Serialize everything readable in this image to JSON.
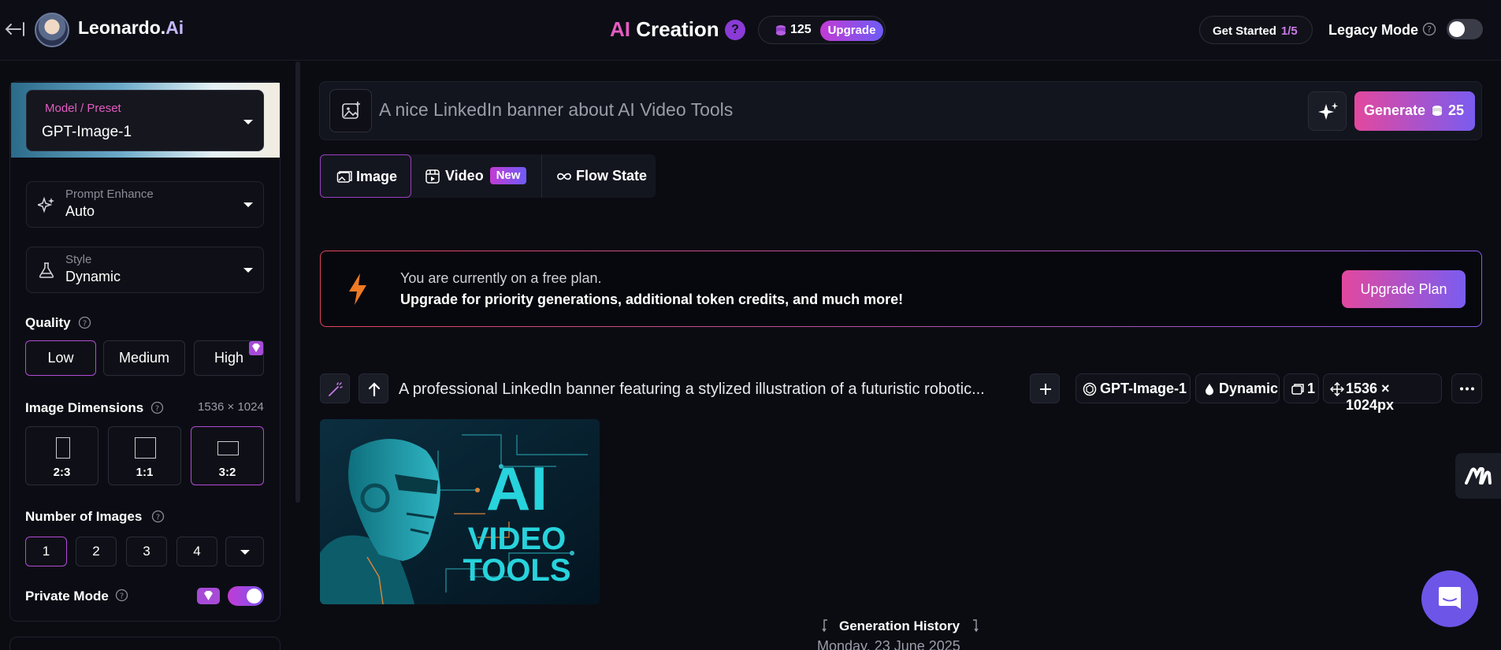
{
  "header": {
    "brand_main": "Leonardo.",
    "brand_ai": "Ai",
    "title_ai": "AI",
    "title_rest": " Creation",
    "help_glyph": "?",
    "token_count": "125",
    "upgrade_label": "Upgrade",
    "get_started_label": "Get Started",
    "get_started_progress": "1/5",
    "legacy_mode_label": "Legacy Mode",
    "legacy_mode_on": false
  },
  "sidebar": {
    "model_label": "Model / Preset",
    "model_value": "GPT-Image-1",
    "prompt_enhance_label": "Prompt Enhance",
    "prompt_enhance_value": "Auto",
    "style_label": "Style",
    "style_value": "Dynamic",
    "quality_title": "Quality",
    "quality_options": [
      "Low",
      "Medium",
      "High"
    ],
    "quality_selected": "Low",
    "dimensions_title": "Image Dimensions",
    "dimensions_readout": "1536 × 1024",
    "dimension_options": [
      "2:3",
      "1:1",
      "3:2"
    ],
    "dimension_selected": "3:2",
    "num_images_title": "Number of Images",
    "num_images_options": [
      "1",
      "2",
      "3",
      "4"
    ],
    "num_images_selected": "1",
    "private_mode_label": "Private Mode",
    "private_mode_on": true
  },
  "prompt": {
    "text": "A nice LinkedIn banner about AI Video Tools",
    "generate_label": "Generate",
    "generate_cost": "25"
  },
  "tabs": {
    "image": "Image",
    "video": "Video",
    "video_badge": "New",
    "flow": "Flow State",
    "active": "Image"
  },
  "banner": {
    "line1": "You are currently on a free plan.",
    "line2": "Upgrade for priority generations, additional token credits, and much more!",
    "button": "Upgrade Plan"
  },
  "generation": {
    "prompt": "A professional LinkedIn banner featuring a stylized illustration of a futuristic robotic...",
    "model": "GPT-Image-1",
    "style": "Dynamic",
    "count": "1",
    "size": "1536 × 1024px",
    "image_text_1": "AI",
    "image_text_2": "VIDEO",
    "image_text_3": "TOOLS"
  },
  "history": {
    "label": "Generation History",
    "date": "Monday, 23 June 2025"
  },
  "colors": {
    "accent_pink": "#e3489e",
    "accent_purple": "#7a5cf0",
    "selected_border": "#b24bd6",
    "background": "#0b0c12"
  }
}
